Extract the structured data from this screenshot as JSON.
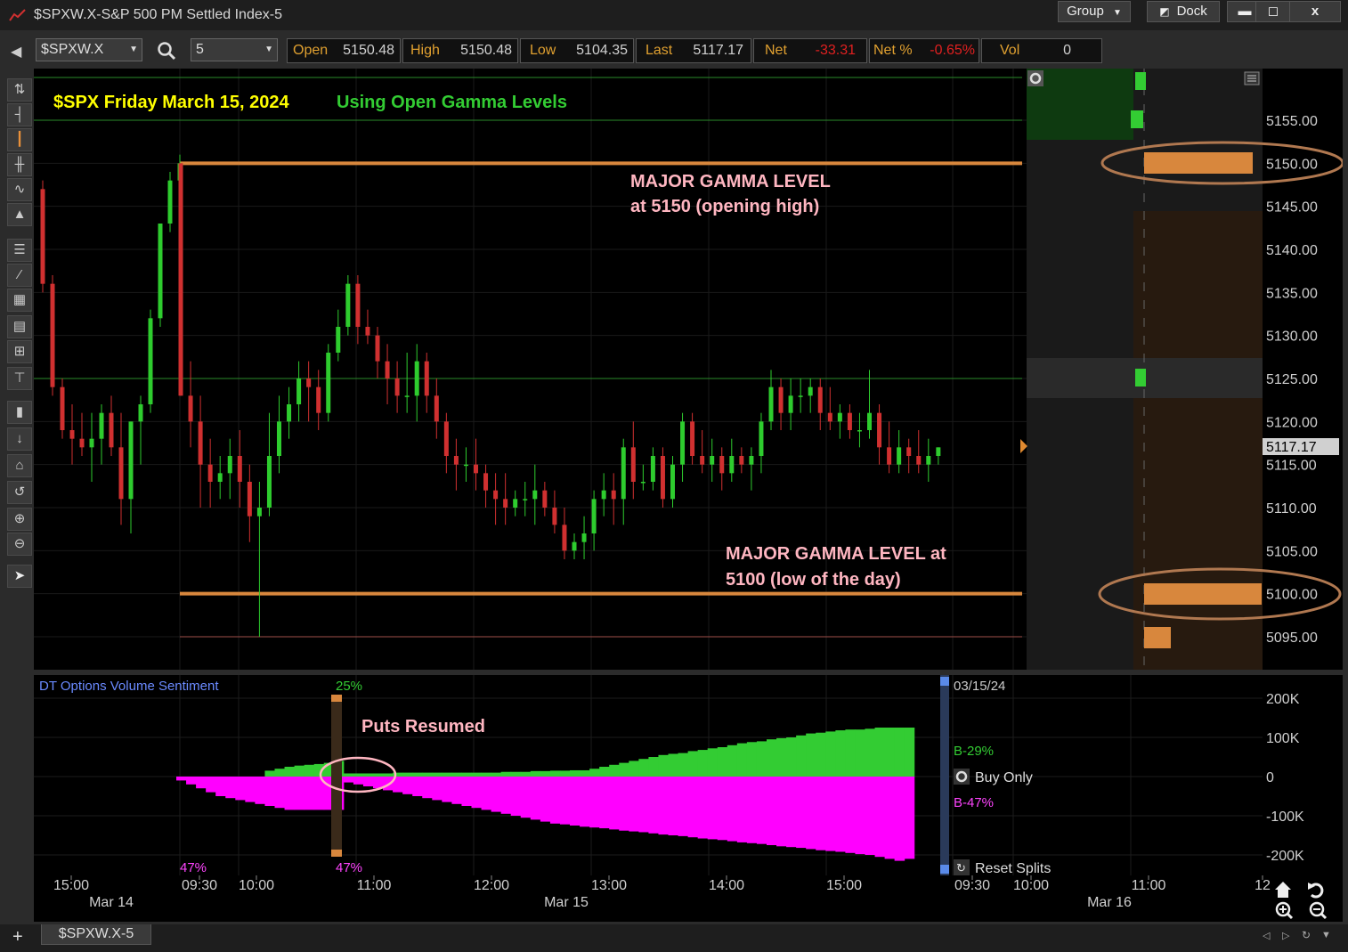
{
  "window": {
    "title": "$SPXW.X-S&P 500 PM Settled Index-5",
    "group_label": "Group",
    "dock_label": "Dock",
    "minimize": "▬",
    "maximize": "◻",
    "close": "x"
  },
  "toolbar": {
    "symbol": "$SPXW.X",
    "interval": "5",
    "quote": [
      {
        "label": "Open",
        "value": "5150.48"
      },
      {
        "label": "High",
        "value": "5150.48"
      },
      {
        "label": "Low",
        "value": "5104.35"
      },
      {
        "label": "Last",
        "value": "5117.17"
      },
      {
        "label": "Net",
        "value": "-33.31"
      },
      {
        "label": "Net %",
        "value": "-0.65%"
      },
      {
        "label": "Vol",
        "value": "0"
      }
    ],
    "negative_color": "#e02020"
  },
  "annotations": {
    "headline_yellow": "$SPX Friday March 15, 2024",
    "headline_green": "Using Open Gamma Levels",
    "gamma_high_line1": "MAJOR GAMMA LEVEL",
    "gamma_high_line2": "at 5150 (opening high)",
    "gamma_low_line1": "MAJOR GAMMA LEVEL at",
    "gamma_low_line2": "5100 (low of the day)",
    "puts_resumed": "Puts Resumed"
  },
  "price_axis": {
    "ticks": [
      "5155.00",
      "5150.00",
      "5145.00",
      "5140.00",
      "5135.00",
      "5130.00",
      "5125.00",
      "5120.00",
      "5115.00",
      "5110.00",
      "5105.00",
      "5100.00",
      "5095.00"
    ],
    "last_price_tag": "5117.17"
  },
  "subchart": {
    "title": "DT Options Volume Sentiment",
    "date_label": "03/15/24",
    "ticks": [
      "200K",
      "100K",
      "0",
      "-100K",
      "-200K"
    ],
    "pct_top": "25%",
    "pct_bottom_left": "47%",
    "pct_bottom_marker": "47%",
    "buy_pct": "B-29%",
    "sell_pct": "B-47%",
    "buy_only_label": "Buy Only",
    "reset_splits_label": "Reset Splits"
  },
  "time_axis": {
    "labels": [
      "15:00",
      "09:30",
      "10:00",
      "11:00",
      "12:00",
      "13:00",
      "14:00",
      "15:00",
      "09:30",
      "10:00",
      "11:00",
      "12"
    ],
    "dates": [
      "Mar 14",
      "Mar 15",
      "Mar 16"
    ]
  },
  "tabs": {
    "add": "+",
    "active": "$SPXW.X-5"
  },
  "colors": {
    "up": "#2ecc2e",
    "down": "#d03030",
    "gamma": "#d8873d",
    "buy_area": "#33cc33",
    "sell_area": "#ff00ff"
  },
  "chart_data": {
    "type": "candlestick",
    "symbol": "$SPXW.X",
    "interval_minutes": 5,
    "y_range": [
      5090,
      5160
    ],
    "gamma_levels": [
      5150,
      5100
    ],
    "last": 5117.17,
    "candles_prev_day": [
      [
        5147,
        5148,
        5135,
        5136
      ],
      [
        5136,
        5137,
        5123,
        5124
      ],
      [
        5124,
        5125,
        5118,
        5119
      ],
      [
        5119,
        5122,
        5115,
        5118
      ],
      [
        5118,
        5121,
        5116,
        5117
      ],
      [
        5117,
        5121,
        5113,
        5118
      ],
      [
        5118,
        5122,
        5115,
        5121
      ],
      [
        5121,
        5123,
        5116,
        5117
      ],
      [
        5117,
        5121,
        5108,
        5111
      ],
      [
        5111,
        5120,
        5107,
        5120
      ],
      [
        5120,
        5123,
        5115,
        5122
      ],
      [
        5122,
        5133,
        5121,
        5132
      ],
      [
        5132,
        5143,
        5131,
        5143
      ],
      [
        5143,
        5149,
        5142,
        5148
      ],
      [
        5148,
        5151,
        5146,
        5150
      ]
    ],
    "candles_mar15": [
      [
        5150,
        5150,
        5123,
        5123
      ],
      [
        5123,
        5127,
        5117,
        5120
      ],
      [
        5120,
        5123,
        5110,
        5115
      ],
      [
        5115,
        5118,
        5110,
        5113
      ],
      [
        5113,
        5116,
        5111,
        5114
      ],
      [
        5114,
        5118,
        5111,
        5116
      ],
      [
        5116,
        5119,
        5110,
        5113
      ],
      [
        5113,
        5115,
        5106,
        5109
      ],
      [
        5109,
        5113,
        5095,
        5110
      ],
      [
        5110,
        5121,
        5109,
        5116
      ],
      [
        5116,
        5123,
        5114,
        5120
      ],
      [
        5120,
        5124,
        5118,
        5122
      ],
      [
        5122,
        5127,
        5120,
        5125
      ],
      [
        5125,
        5127,
        5120,
        5124
      ],
      [
        5124,
        5126,
        5119,
        5121
      ],
      [
        5121,
        5129,
        5120,
        5128
      ],
      [
        5128,
        5133,
        5127,
        5131
      ],
      [
        5131,
        5137,
        5130,
        5136
      ],
      [
        5136,
        5137,
        5129,
        5131
      ],
      [
        5131,
        5133,
        5129,
        5130
      ],
      [
        5130,
        5131,
        5125,
        5127
      ],
      [
        5127,
        5129,
        5122,
        5125
      ],
      [
        5125,
        5127,
        5121,
        5123
      ],
      [
        5123,
        5128,
        5121,
        5123
      ],
      [
        5123,
        5129,
        5120,
        5127
      ],
      [
        5127,
        5128,
        5121,
        5123
      ],
      [
        5123,
        5125,
        5118,
        5120
      ],
      [
        5120,
        5121,
        5114,
        5116
      ],
      [
        5116,
        5118,
        5112,
        5115
      ],
      [
        5115,
        5117,
        5113,
        5115
      ],
      [
        5115,
        5118,
        5112,
        5114
      ],
      [
        5114,
        5115,
        5110,
        5112
      ],
      [
        5112,
        5114,
        5108,
        5111
      ],
      [
        5111,
        5114,
        5108,
        5110
      ],
      [
        5110,
        5112,
        5109,
        5111
      ],
      [
        5111,
        5113,
        5109,
        5111
      ],
      [
        5111,
        5115,
        5108,
        5112
      ],
      [
        5112,
        5113,
        5109,
        5110
      ],
      [
        5110,
        5112,
        5107,
        5108
      ],
      [
        5108,
        5110,
        5104,
        5105
      ],
      [
        5105,
        5107,
        5104,
        5106
      ],
      [
        5106,
        5109,
        5104,
        5107
      ],
      [
        5107,
        5112,
        5105,
        5111
      ],
      [
        5111,
        5114,
        5109,
        5112
      ],
      [
        5112,
        5114,
        5108,
        5111
      ],
      [
        5111,
        5118,
        5108,
        5117
      ],
      [
        5117,
        5120,
        5111,
        5113
      ],
      [
        5113,
        5115,
        5112,
        5113
      ],
      [
        5113,
        5117,
        5112,
        5116
      ],
      [
        5116,
        5117,
        5110,
        5111
      ],
      [
        5111,
        5116,
        5110,
        5115
      ],
      [
        5115,
        5121,
        5113,
        5120
      ],
      [
        5120,
        5121,
        5115,
        5116
      ],
      [
        5116,
        5119,
        5114,
        5115
      ],
      [
        5115,
        5118,
        5113,
        5116
      ],
      [
        5116,
        5117,
        5112,
        5114
      ],
      [
        5114,
        5118,
        5113,
        5116
      ],
      [
        5116,
        5117,
        5114,
        5115
      ],
      [
        5115,
        5117,
        5112,
        5116
      ],
      [
        5116,
        5121,
        5114,
        5120
      ],
      [
        5120,
        5126,
        5119,
        5124
      ],
      [
        5124,
        5125,
        5119,
        5121
      ],
      [
        5121,
        5125,
        5119,
        5123
      ],
      [
        5123,
        5125,
        5121,
        5123
      ],
      [
        5123,
        5125,
        5121,
        5124
      ],
      [
        5124,
        5125,
        5119,
        5121
      ],
      [
        5121,
        5124,
        5119,
        5120
      ],
      [
        5120,
        5122,
        5118,
        5121
      ],
      [
        5121,
        5122,
        5118,
        5119
      ],
      [
        5119,
        5121,
        5117,
        5119
      ],
      [
        5119,
        5126,
        5118,
        5121
      ],
      [
        5121,
        5122,
        5115,
        5117
      ],
      [
        5117,
        5120,
        5114,
        5115
      ],
      [
        5115,
        5119,
        5114,
        5117
      ],
      [
        5117,
        5118,
        5114,
        5116
      ],
      [
        5116,
        5119,
        5114,
        5115
      ],
      [
        5115,
        5118,
        5113,
        5116
      ],
      [
        5116,
        5117,
        5115,
        5117
      ]
    ],
    "sentiment": {
      "y_range": [
        -220000,
        220000
      ],
      "buy_volume_k": [
        0,
        0,
        0,
        0,
        0,
        0,
        0,
        0,
        0,
        15,
        20,
        25,
        28,
        30,
        32,
        35,
        40,
        8,
        8,
        8,
        8,
        8,
        10,
        10,
        10,
        10,
        10,
        10,
        10,
        10,
        10,
        10,
        10,
        12,
        12,
        12,
        14,
        14,
        15,
        15,
        16,
        16,
        20,
        25,
        30,
        35,
        40,
        45,
        50,
        55,
        58,
        60,
        65,
        68,
        72,
        75,
        80,
        85,
        88,
        90,
        95,
        98,
        100,
        105,
        110,
        112,
        115,
        118,
        120,
        120,
        122,
        125,
        125,
        125,
        125
      ],
      "sell_volume_k": [
        -10,
        -20,
        -30,
        -40,
        -50,
        -55,
        -60,
        -65,
        -70,
        -75,
        -80,
        -85,
        -85,
        -85,
        -85,
        -85,
        -85,
        -15,
        -20,
        -25,
        -30,
        -35,
        -40,
        -45,
        -50,
        -55,
        -60,
        -65,
        -70,
        -75,
        -80,
        -85,
        -90,
        -95,
        -100,
        -105,
        -110,
        -115,
        -120,
        -122,
        -125,
        -128,
        -130,
        -132,
        -135,
        -138,
        -140,
        -142,
        -145,
        -148,
        -150,
        -152,
        -155,
        -158,
        -160,
        -162,
        -165,
        -168,
        -170,
        -172,
        -175,
        -178,
        -180,
        -182,
        -185,
        -188,
        -190,
        -192,
        -195,
        -198,
        -200,
        -205,
        -210,
        -215,
        -210
      ]
    }
  }
}
